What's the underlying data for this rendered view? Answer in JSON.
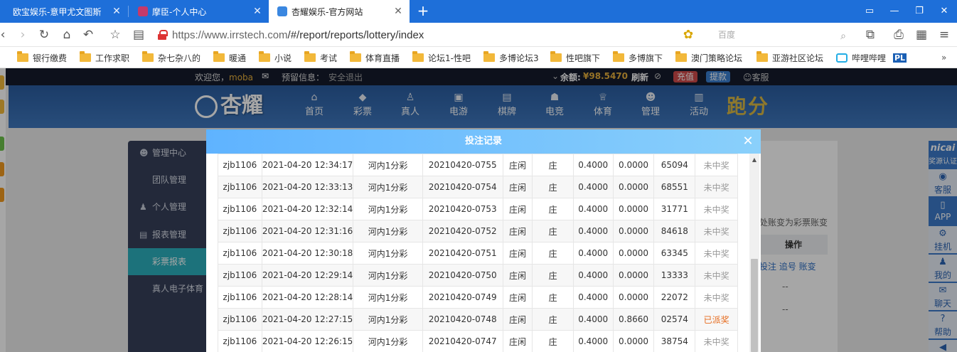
{
  "browser": {
    "tabs": [
      {
        "title": "欧宝娱乐-意甲尤文图斯",
        "active": false
      },
      {
        "title": "摩臣-个人中心",
        "active": false
      },
      {
        "title": "杏耀娱乐-官方网站",
        "active": true
      }
    ],
    "url_host": "https://www.irrstech.com",
    "url_path": "/#/report/reports/lottery/index",
    "search_placeholder": "百度",
    "bookmarks": [
      "银行缴费",
      "工作求职",
      "杂七杂八的",
      "暖通",
      "小说",
      "考试",
      "体育直播",
      "论坛1-性吧",
      "多博论坛3",
      "性吧旗下",
      "多博旗下",
      "澳门策略论坛",
      "亚游社区论坛",
      "哔哩哔哩",
      "PL"
    ]
  },
  "topline": {
    "welcome": "欢迎您，",
    "username": "moba",
    "reserved_label": "预留信息：",
    "logout": "安全退出",
    "balance_label": "余额:",
    "balance": "¥98.5470",
    "refresh": "刷新",
    "deposit": "充值",
    "withdraw": "提款",
    "service": "客服"
  },
  "header": {
    "logo": "杏耀",
    "brand_gold": "跑分",
    "nav": [
      "首页",
      "彩票",
      "真人",
      "电游",
      "棋牌",
      "电竞",
      "体育",
      "管理",
      "活动"
    ]
  },
  "sidebar": {
    "items": [
      {
        "label": "管理中心",
        "type": "section"
      },
      {
        "label": "团队管理",
        "type": "sub"
      },
      {
        "label": "个人管理",
        "type": "section"
      },
      {
        "label": "报表管理",
        "type": "section"
      },
      {
        "label": "彩票报表",
        "type": "sub",
        "active": true
      },
      {
        "label": "真人电子体育",
        "type": "sub"
      }
    ]
  },
  "content": {
    "transfer_note": "处账变为彩票账变",
    "op_header": "操作",
    "op_links": "投注 追号 账变",
    "dash": "--"
  },
  "right_float": [
    "奖源认证",
    "客服",
    "APP",
    "挂机",
    "我的",
    "聊天",
    "帮助"
  ],
  "right_float_top": "nicai",
  "modal": {
    "title": "投注记录",
    "rows": [
      {
        "user": "zjb1106",
        "time": "2021-04-20 12:34:17",
        "game": "河内1分彩",
        "issue": "20210420-0755",
        "play": "庄闲",
        "content": "庄",
        "amount": "0.4000",
        "bonus": "0.0000",
        "code": "65094",
        "status": "未中奖"
      },
      {
        "user": "zjb1106",
        "time": "2021-04-20 12:33:13",
        "game": "河内1分彩",
        "issue": "20210420-0754",
        "play": "庄闲",
        "content": "庄",
        "amount": "0.4000",
        "bonus": "0.0000",
        "code": "68551",
        "status": "未中奖"
      },
      {
        "user": "zjb1106",
        "time": "2021-04-20 12:32:14",
        "game": "河内1分彩",
        "issue": "20210420-0753",
        "play": "庄闲",
        "content": "庄",
        "amount": "0.4000",
        "bonus": "0.0000",
        "code": "31771",
        "status": "未中奖"
      },
      {
        "user": "zjb1106",
        "time": "2021-04-20 12:31:16",
        "game": "河内1分彩",
        "issue": "20210420-0752",
        "play": "庄闲",
        "content": "庄",
        "amount": "0.4000",
        "bonus": "0.0000",
        "code": "84618",
        "status": "未中奖"
      },
      {
        "user": "zjb1106",
        "time": "2021-04-20 12:30:18",
        "game": "河内1分彩",
        "issue": "20210420-0751",
        "play": "庄闲",
        "content": "庄",
        "amount": "0.4000",
        "bonus": "0.0000",
        "code": "63345",
        "status": "未中奖"
      },
      {
        "user": "zjb1106",
        "time": "2021-04-20 12:29:14",
        "game": "河内1分彩",
        "issue": "20210420-0750",
        "play": "庄闲",
        "content": "庄",
        "amount": "0.4000",
        "bonus": "0.0000",
        "code": "13333",
        "status": "未中奖"
      },
      {
        "user": "zjb1106",
        "time": "2021-04-20 12:28:14",
        "game": "河内1分彩",
        "issue": "20210420-0749",
        "play": "庄闲",
        "content": "庄",
        "amount": "0.4000",
        "bonus": "0.0000",
        "code": "22072",
        "status": "未中奖"
      },
      {
        "user": "zjb1106",
        "time": "2021-04-20 12:27:15",
        "game": "河内1分彩",
        "issue": "20210420-0748",
        "play": "庄闲",
        "content": "庄",
        "amount": "0.4000",
        "bonus": "0.8660",
        "code": "02574",
        "status": "已派奖"
      },
      {
        "user": "zjb1106",
        "time": "2021-04-20 12:26:15",
        "game": "河内1分彩",
        "issue": "20210420-0747",
        "play": "庄闲",
        "content": "庄",
        "amount": "0.4000",
        "bonus": "0.0000",
        "code": "38754",
        "status": "未中奖"
      }
    ]
  },
  "colors": {
    "tabbar": "#1e6fd9",
    "active_sidebar": "#2bb0bd",
    "win_status": "#e66b1d",
    "modal_header": "#5fb3ff"
  }
}
